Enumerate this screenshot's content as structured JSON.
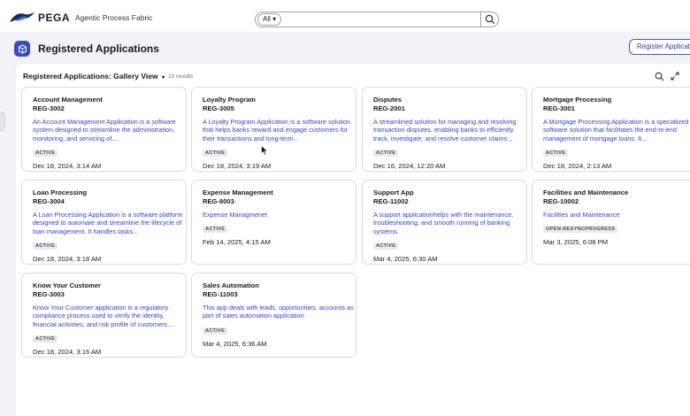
{
  "header": {
    "brand": "PEGA",
    "product": "Agentic Process Fabric",
    "search": {
      "scope_label": "All ▾",
      "value": "",
      "placeholder": ""
    }
  },
  "page": {
    "title": "Registered Applications",
    "register_button": "Register Application"
  },
  "gallery": {
    "title": "Registered Applications: Gallery View",
    "chevron": "▾",
    "count": "10 results"
  },
  "cards": [
    {
      "title": "Account Management",
      "id": "REG-3002",
      "description": "An Account Management Application is a software system designed to streamline the administration, monitoring, and servicing of...",
      "status": "ACTIVE",
      "date": "Dec 18, 2024, 3:14 AM"
    },
    {
      "title": "Loyalty Program",
      "id": "REG-3005",
      "description": "A Loyalty Program Application is a software solution that helps banks reward and engage customers for their transactions and long-term...",
      "status": "ACTIVE",
      "date": "Dec 18, 2024, 3:19 AM"
    },
    {
      "title": "Disputes",
      "id": "REG-2001",
      "description": "A streamlined solution for managing and resolving transaction disputes, enabling banks to efficiently track, investigate, and resolve customer claims...",
      "status": "ACTIVE",
      "date": "Dec 16, 2024, 12:20 AM"
    },
    {
      "title": "Mortgage Processing",
      "id": "REG-3001",
      "description": "A Mortgage Processing Application is a specialized software solution that facilitates the end-to-end management of mortgage loans. It...",
      "status": "ACTIVE",
      "date": "Dec 18, 2024, 2:13 AM"
    },
    {
      "title": "Loan Processing",
      "id": "REG-3004",
      "description": "A Loan Processing Application is a software platform designed to automate and streamline the lifecycle of loan management. It handles tasks...",
      "status": "ACTIVE",
      "date": "Dec 18, 2024, 3:18 AM"
    },
    {
      "title": "Expense Management",
      "id": "REG-8003",
      "description": "Expense Managmenet",
      "status": "ACTIVE",
      "date": "Feb 14, 2025, 4:15 AM"
    },
    {
      "title": "Support App",
      "id": "REG-11002",
      "description": "A support applicationhelps with the maintenance, troubleshooting, and smooth running of banking systems.",
      "status": "ACTIVE",
      "date": "Mar 4, 2025, 6:30 AM"
    },
    {
      "title": "Facilities and Maintenance",
      "id": "REG-10002",
      "description": "Facilities and Maintenance",
      "status": "OPEN-RESYNCPROGRESS",
      "date": "Mar 3, 2025, 6:08 PM"
    },
    {
      "title": "Know Your Customer",
      "id": "REG-3003",
      "description": "Know Your Customer application is a regulatory compliance process used to verify the identity, financial activities, and risk profile of customers....",
      "status": "ACTIVE",
      "date": "Dec 18, 2024, 3:16 AM"
    },
    {
      "title": "Sales Automation",
      "id": "REG-11003",
      "description": "This app deals with leads, opportunities, accounts as part of sales automation application",
      "status": "ACTIVE",
      "date": "Mar 4, 2025, 6:36 AM"
    }
  ],
  "icons": {
    "logo": "pega-bird-icon",
    "search": "search-icon",
    "app": "app-cube-icon",
    "expand": "expand-arrows-icon",
    "cursor": "mouse-pointer-icon"
  },
  "colors": {
    "accent": "#3b4cc0",
    "link_text": "#3345c9",
    "badge_bg": "#e8eaee",
    "shell_bg": "#f1f3f6"
  }
}
